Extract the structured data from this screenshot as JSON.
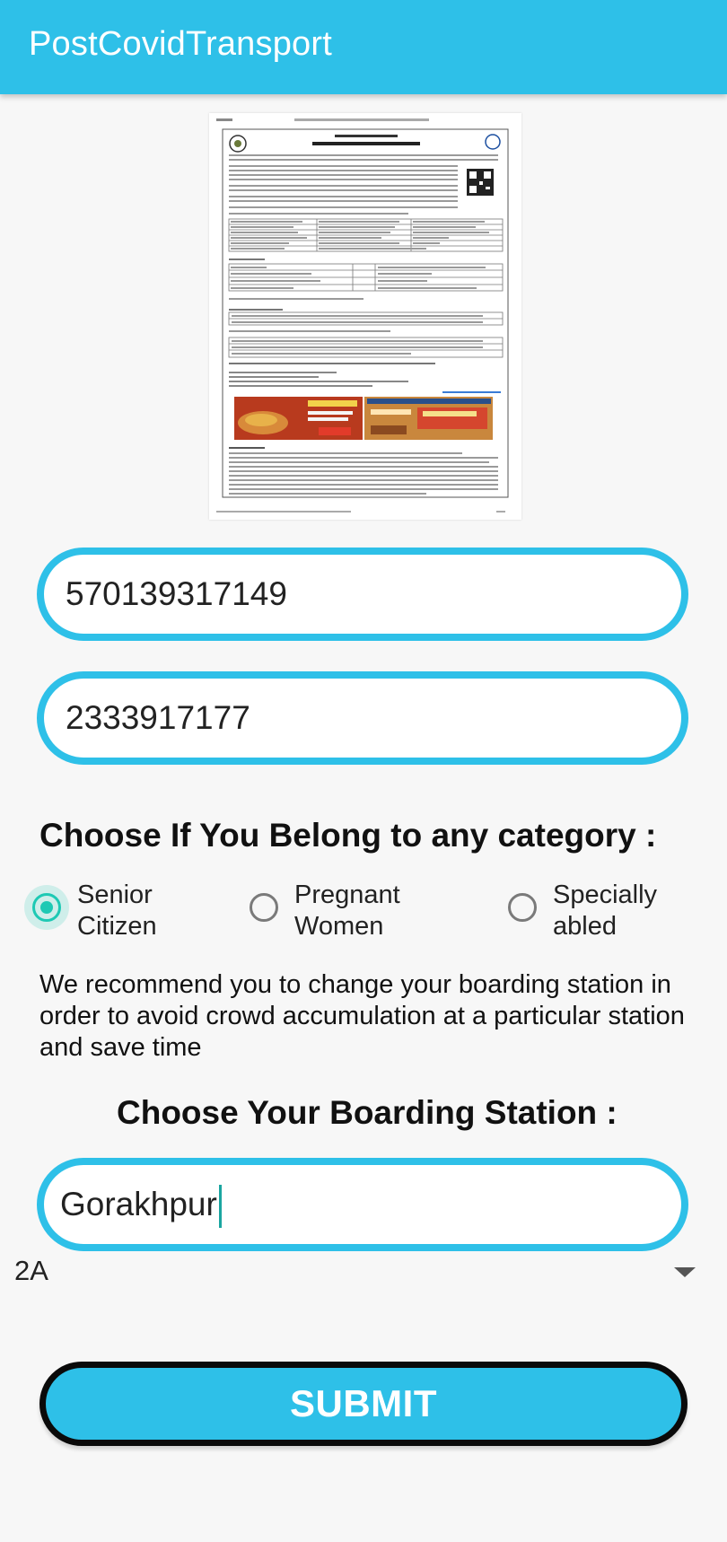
{
  "app_bar": {
    "title": "PostCovidTransport",
    "color": "#2ec0e8"
  },
  "ticket_image": {
    "name": "reservation-slip-image"
  },
  "form": {
    "pnr_value": "570139317149",
    "phone_value": "2333917177",
    "category_heading": "Choose If You Belong to any category :",
    "categories": [
      {
        "label": "Senior Citizen",
        "checked": true
      },
      {
        "label": "Pregnant Women",
        "checked": false
      },
      {
        "label": "Specially abled",
        "checked": false
      }
    ],
    "recommendation": "We recommend you to change your boarding station in order to avoid crowd accumulation at a particular station and save time",
    "boarding_heading": "Choose Your Boarding Station :",
    "station_value": "Gorakhpur",
    "class_value": "2A",
    "submit_label": "SUBMIT"
  },
  "colors": {
    "accent": "#2ec0e8",
    "radio_checked": "#1ec9b4",
    "submit_border": "#0a0a0a"
  }
}
